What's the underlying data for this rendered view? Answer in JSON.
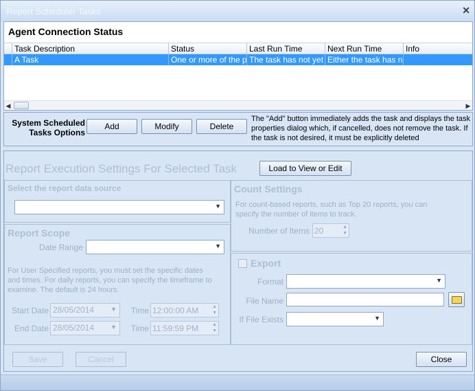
{
  "window": {
    "title": "Report Scheduler Tasks",
    "close_glyph": "✕"
  },
  "status": {
    "title": "Agent Connection Status",
    "columns": [
      "Task Description",
      "Status",
      "Last Run Time",
      "Next Run Time",
      "Info"
    ],
    "rows": [
      [
        "A Task",
        "One or more of the pro",
        "The task has not yet ru",
        "Either the task has no",
        ""
      ]
    ]
  },
  "options": {
    "label": "System Scheduled Tasks Options",
    "add": "Add",
    "modify": "Modify",
    "delete": "Delete",
    "note": "The \"Add\" button immediately adds the task and displays the task properties dialog which, if cancelled, does not remove the task. If the task is not desired, it must be explicitly deleted"
  },
  "exec": {
    "title": "Report Execution Settings For Selected Task",
    "load_button": "Load to View or Edit",
    "data_source": {
      "title": "Select the report data source",
      "value": ""
    },
    "scope": {
      "title": "Report Scope",
      "date_range_label": "Date Range",
      "date_range_value": "",
      "help": "For User Specified reports, you must set the specific dates and times.  For daily reports, you can specify the timeframe to examine.  The default is 24 hours.",
      "start_date_label": "Start Date",
      "start_date": "28/05/2014",
      "end_date_label": "End Date",
      "end_date": "28/05/2014",
      "start_time_label": "Time",
      "start_time": "12:00:00 AM",
      "end_time_label": "Time",
      "end_time": "11:59:59 PM"
    },
    "count": {
      "title": "Count Settings",
      "help": "For count-based reports, such as Top 20 reports, you can specify the number of items to track.",
      "items_label": "Number of Items",
      "items_value": "20"
    },
    "export": {
      "title": "Export",
      "checked": false,
      "format_label": "Format",
      "format_value": "",
      "file_name_label": "File Name",
      "file_name_value": "",
      "if_exists_label": "If File Exists",
      "if_exists_value": ""
    }
  },
  "footer": {
    "save": "Save",
    "cancel": "Cancel",
    "close": "Close"
  }
}
